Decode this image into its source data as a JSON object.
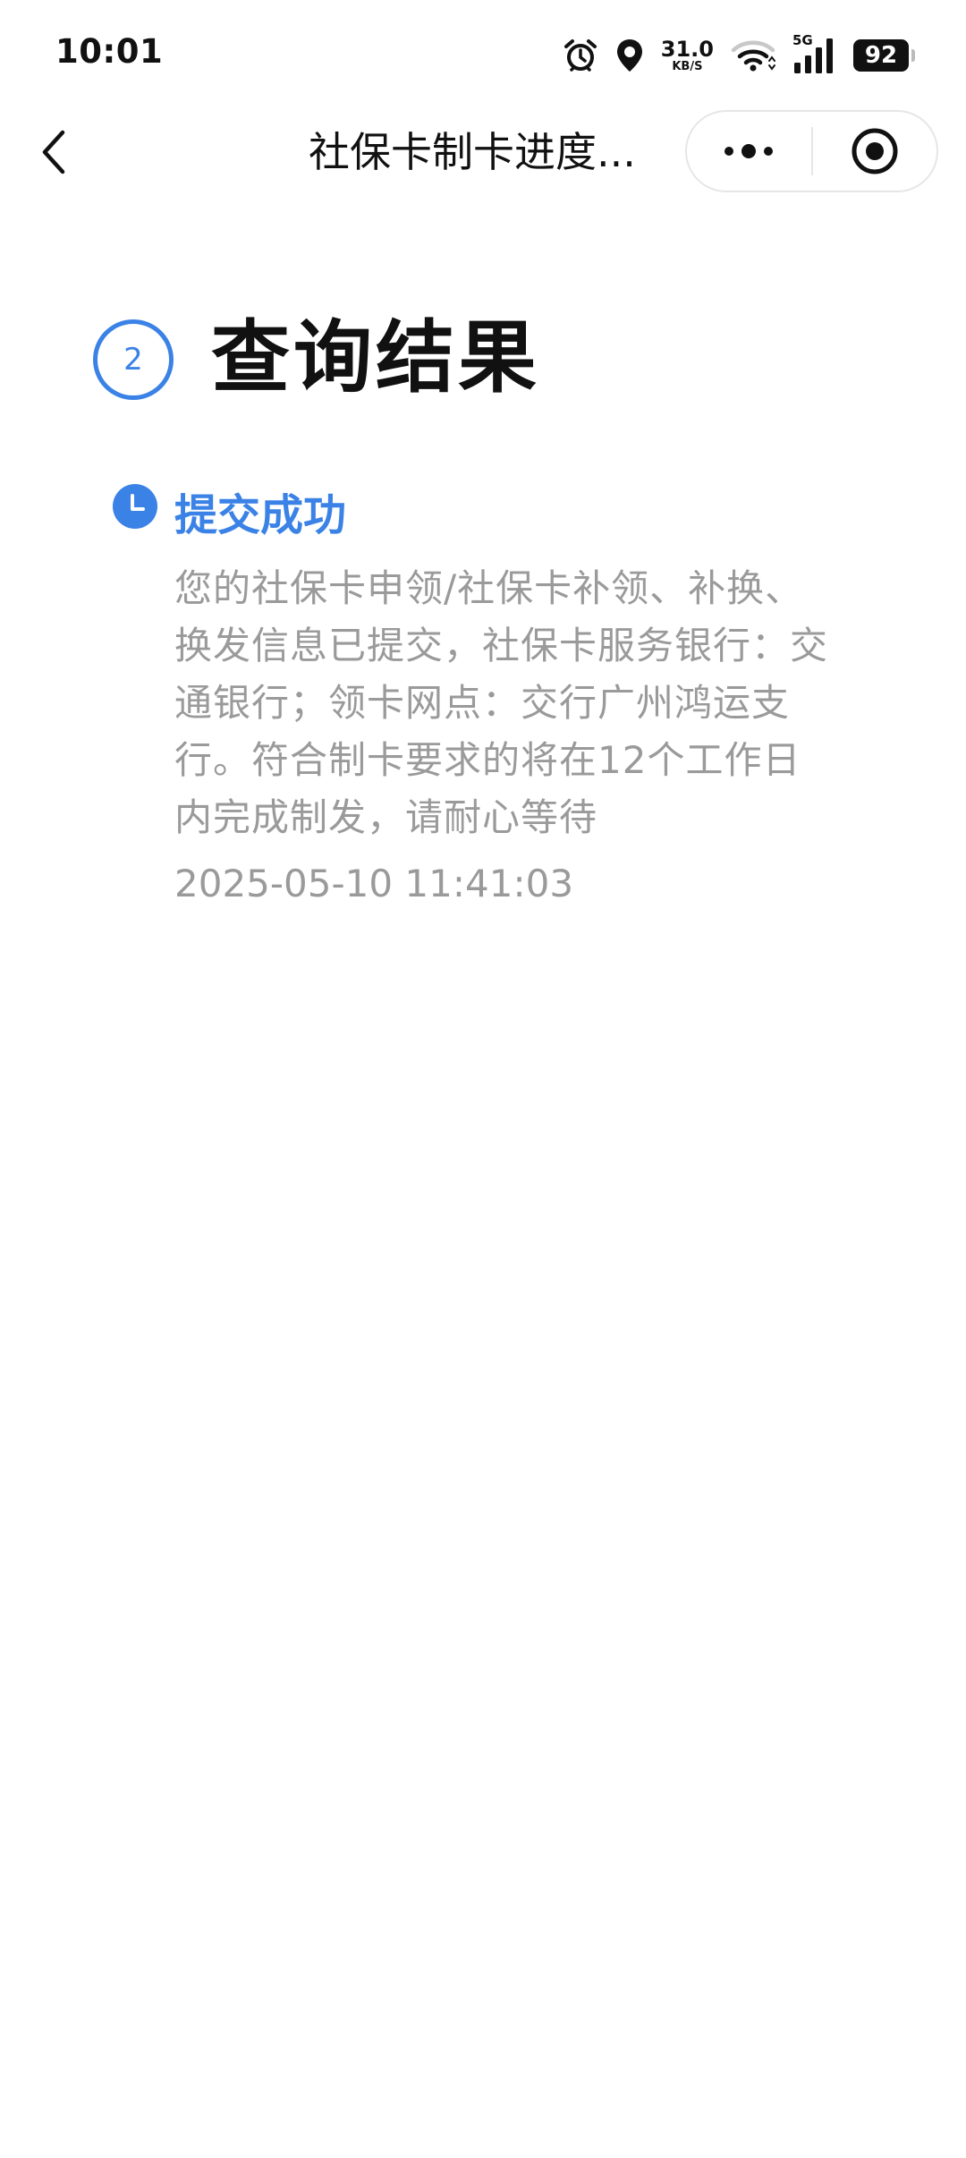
{
  "status_bar": {
    "time": "10:01",
    "net_speed": "31.0",
    "net_unit": "KB/S",
    "network": "5G",
    "battery": "92",
    "icons": [
      "alarm-icon",
      "location-icon",
      "wifi-icon",
      "signal-icon",
      "battery-icon"
    ]
  },
  "nav": {
    "title": "社保卡制卡进度...",
    "back_icon": "chevron-left-icon",
    "more_icon": "more-dots-icon",
    "close_icon": "target-circle-icon"
  },
  "result": {
    "step_number": "2",
    "title": "查询结果"
  },
  "timeline": {
    "status": "提交成功",
    "description": "您的社保卡申领/社保卡补领、补换、换发信息已提交，社保卡服务银行：交通银行；领卡网点：交行广州鸿运支行。符合制卡要求的将在12个工作日内完成制发，请耐心等待",
    "timestamp": "2025-05-10 11:41:03",
    "icon": "clock-icon"
  },
  "colors": {
    "accent": "#3b82e6",
    "muted_text": "#9a9a9a"
  }
}
